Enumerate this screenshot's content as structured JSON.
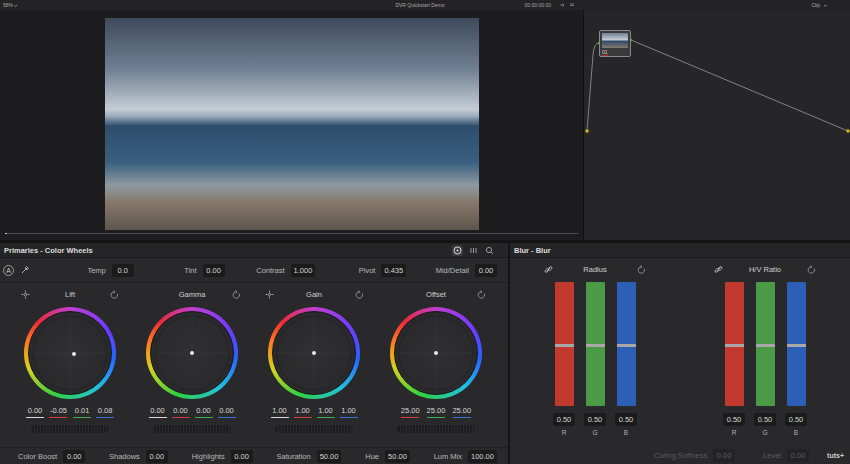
{
  "top_bar": {
    "zoom": "58%",
    "project": "DVR Quickstart Demo",
    "timecode": "00:00:00:00",
    "mode": "Clip"
  },
  "viewer": {
    "scrub": {
      "level": 0
    }
  },
  "node_graph": {
    "nodes": [
      {
        "label": "01"
      }
    ]
  },
  "primaries": {
    "title": "Primaries - Color Wheels",
    "view_modes": [
      {
        "selected": true
      },
      {
        "selected": false
      },
      {
        "selected": false
      }
    ],
    "auto_button": "A",
    "adjustments": [
      {
        "label": "Temp",
        "value": "0.0"
      },
      {
        "label": "Tint",
        "value": "0.00"
      },
      {
        "label": "Contrast",
        "value": "1.000"
      },
      {
        "label": "Pivot",
        "value": "0.435"
      },
      {
        "label": "Mid/Detail",
        "value": "0.00"
      }
    ],
    "wheels": [
      {
        "label": "Lift",
        "has_picker": true,
        "puck": {
          "x": 0.12,
          "y": -0.02
        },
        "values": [
          {
            "value": "0.00",
            "color": "#d8d8d8"
          },
          {
            "value": "-0.05",
            "color": "#d23c3c"
          },
          {
            "value": "0.01",
            "color": "#3fae4a"
          },
          {
            "value": "0.08",
            "color": "#3c6fd8"
          }
        ]
      },
      {
        "label": "Gamma",
        "has_picker": false,
        "puck": {
          "x": 0,
          "y": 0
        },
        "values": [
          {
            "value": "0.00",
            "color": "#d8d8d8"
          },
          {
            "value": "0.00",
            "color": "#d23c3c"
          },
          {
            "value": "0.00",
            "color": "#3fae4a"
          },
          {
            "value": "0.00",
            "color": "#3c6fd8"
          }
        ]
      },
      {
        "label": "Gain",
        "has_picker": true,
        "puck": {
          "x": 0,
          "y": 0
        },
        "values": [
          {
            "value": "1.00",
            "color": "#d8d8d8"
          },
          {
            "value": "1.00",
            "color": "#d23c3c"
          },
          {
            "value": "1.00",
            "color": "#3fae4a"
          },
          {
            "value": "1.00",
            "color": "#3c6fd8"
          }
        ]
      },
      {
        "label": "Offset",
        "has_picker": false,
        "puck": {
          "x": 0,
          "y": 0
        },
        "values": [
          {
            "value": "25.00",
            "color": "#d23c3c"
          },
          {
            "value": "25.00",
            "color": "#3fae4a"
          },
          {
            "value": "25.00",
            "color": "#3c6fd8"
          }
        ]
      }
    ],
    "controls": [
      {
        "label": "Color Boost",
        "value": "0.00"
      },
      {
        "label": "Shadows",
        "value": "0.00"
      },
      {
        "label": "Highlights",
        "value": "0.00"
      },
      {
        "label": "Saturation",
        "value": "50.00"
      },
      {
        "label": "Hue",
        "value": "50.00"
      },
      {
        "label": "Lum Mix",
        "value": "100.00"
      }
    ]
  },
  "blur": {
    "title": "Blur - Blur",
    "groups": [
      {
        "label": "Radius",
        "channels": [
          {
            "label": "R",
            "value": "0.50",
            "level": 0.5,
            "color": "#c23a2e"
          },
          {
            "label": "G",
            "value": "0.50",
            "level": 0.5,
            "color": "#4a9a46"
          },
          {
            "label": "B",
            "value": "0.50",
            "level": 0.5,
            "color": "#2d5fb8"
          }
        ]
      },
      {
        "label": "H/V Ratio",
        "channels": [
          {
            "label": "R",
            "value": "0.50",
            "level": 0.5,
            "color": "#c23a2e"
          },
          {
            "label": "G",
            "value": "0.50",
            "level": 0.5,
            "color": "#4a9a46"
          },
          {
            "label": "B",
            "value": "0.50",
            "level": 0.5,
            "color": "#2d5fb8"
          }
        ]
      }
    ],
    "footer": [
      {
        "label": "Coring Softness",
        "value": "0.00",
        "disabled": true
      },
      {
        "label": "Level",
        "value": "0.00",
        "disabled": true
      }
    ]
  },
  "watermark": "tuts+"
}
